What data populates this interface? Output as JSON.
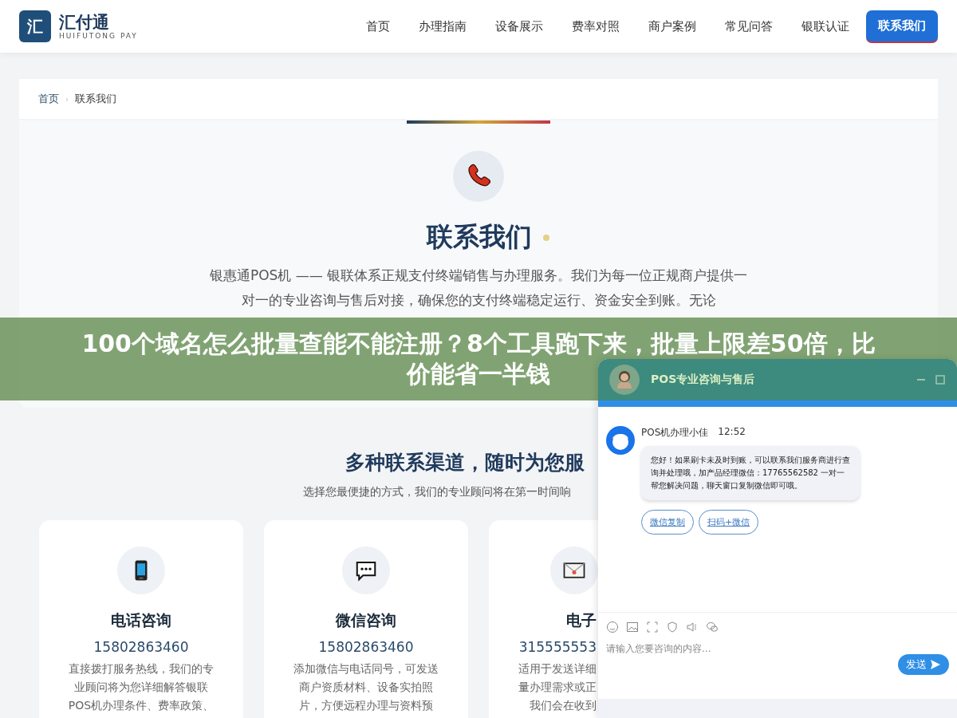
{
  "header": {
    "logo_mark": "汇",
    "brand": "汇付通",
    "brand_sub": "HUIFUTONG PAY",
    "nav": [
      {
        "label": "首页",
        "selected": false
      },
      {
        "label": "办理指南",
        "selected": false
      },
      {
        "label": "设备展示",
        "selected": false
      },
      {
        "label": "费率对照",
        "selected": false
      },
      {
        "label": "商户案例",
        "selected": false
      },
      {
        "label": "常见问答",
        "selected": false
      },
      {
        "label": "银联认证",
        "selected": false
      },
      {
        "label": "联系我们",
        "selected": true
      }
    ]
  },
  "breadcrumb": [
    "首页",
    "联系我们"
  ],
  "breadcrumb_separator": "›",
  "hero": {
    "title": "联系我们",
    "intro": "银惠通POS机 —— 银联体系正规支付终端销售与办理服务。我们为每一位正规商户提供一对一的专业咨询与售后对接，确保您的支付终端稳定运行、资金安全到账。无论"
  },
  "banner": {
    "lines": [
      "100个域名怎么批量查能不能注册？8个工具跑下来，批量上限差50倍，比",
      "价能省一半钱"
    ]
  },
  "channels": {
    "title": "多种联系渠道，随时为您服",
    "subtitle": "选择您最便捷的方式，我们的专业顾问将在第一时间响",
    "cards": [
      {
        "kind": "phone",
        "title": "电话咨询",
        "number": "15802863460",
        "lines": [
          "直接拨打服务热线，我们的专",
          "业顾问将为您详细解答银联",
          "POS机办理条件、费率政策、"
        ]
      },
      {
        "kind": "chat",
        "title": "微信咨询",
        "number": "15802863460",
        "lines": [
          "添加微信与电话同号，可发送",
          "商户资质材料、设备实拍照",
          "片，方便远程办理与资料预"
        ]
      },
      {
        "kind": "mail",
        "title": "电子",
        "number": "315555553",
        "lines": [
          "适用于发送详细",
          "量办理需求或正",
          "我们会在收到"
        ]
      }
    ]
  },
  "chat": {
    "title": "POS专业咨询与售后",
    "agent": "POS机办理小佳",
    "time": "12:52",
    "message": "您好！如果刷卡未及时到账，可以联系我们服务商进行查询并处理哦，加产品经理微信：17765562582 一对一帮您解决问题，聊天窗口复制微信即可哦。",
    "actions": [
      "微信复制",
      "扫码+微信"
    ],
    "placeholder": "请输入您要咨询的内容...",
    "send": "发送"
  }
}
